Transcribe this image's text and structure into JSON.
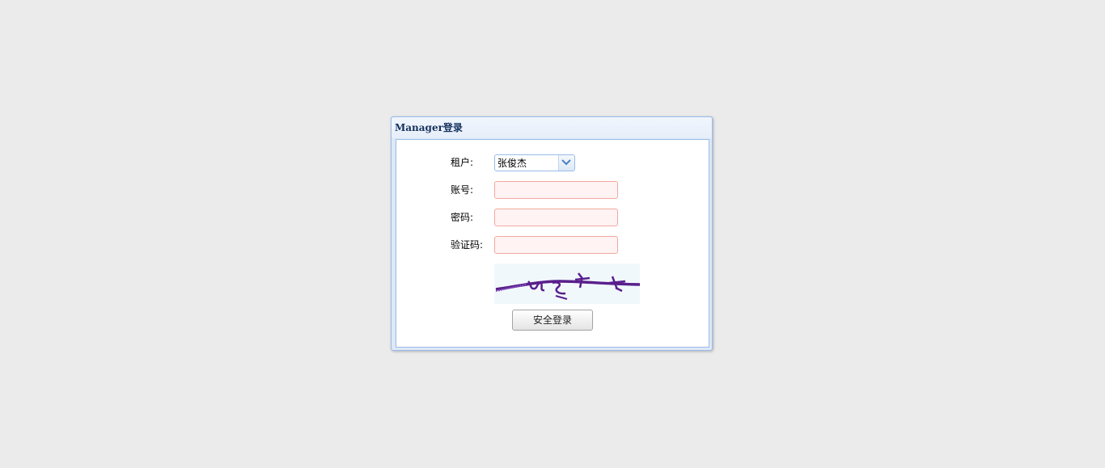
{
  "login_panel": {
    "title": "Manager登录",
    "tenant": {
      "label": "租户:",
      "selected": "张俊杰"
    },
    "account": {
      "label": "账号:",
      "value": ""
    },
    "password": {
      "label": "密码:",
      "value": ""
    },
    "captcha": {
      "label": "验证码:",
      "value": "",
      "image_icon": "captcha-image"
    },
    "submit_label": "安全登录"
  },
  "colors": {
    "page_background": "#ebebeb",
    "panel_border": "#99bbe8",
    "title_text": "#15325e",
    "input_invalid_border": "#f3a9a0",
    "input_invalid_background": "#fff3f3",
    "captcha_ink": "#5a1f8c"
  }
}
